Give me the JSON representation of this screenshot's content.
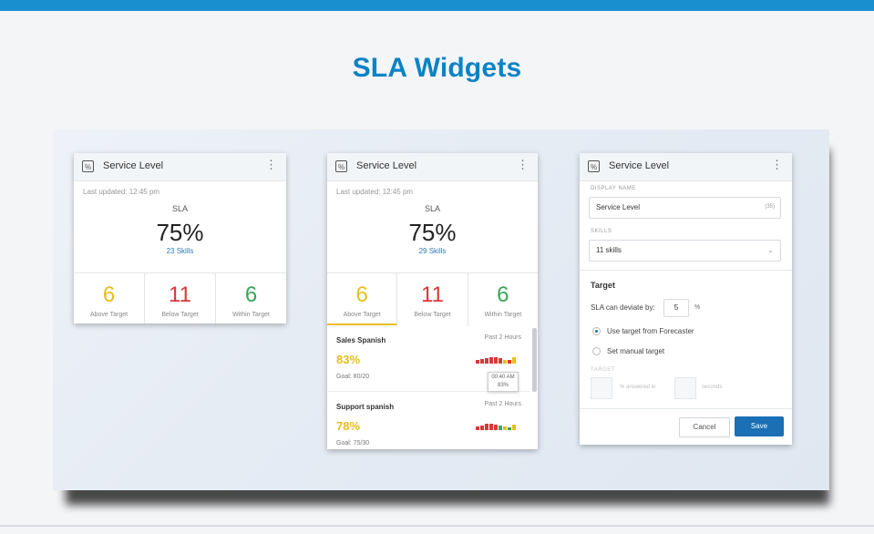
{
  "page": {
    "title": "SLA Widgets",
    "accent_color": "#1a8fd0"
  },
  "widget1": {
    "title": "Service Level",
    "icon": "percent-icon",
    "updated": "Last updated: 12:45 pm",
    "sla_label": "SLA",
    "sla_value": "75%",
    "skills_link": "23 Skills",
    "stats": [
      {
        "value": "6",
        "label": "Above Target"
      },
      {
        "value": "11",
        "label": "Below Target"
      },
      {
        "value": "6",
        "label": "Within Target"
      }
    ]
  },
  "widget2": {
    "title": "Service Level",
    "icon": "percent-icon",
    "updated": "Last updated: 12:45 pm",
    "sla_label": "SLA",
    "sla_value": "75%",
    "skills_link": "29 Skills",
    "stats": [
      {
        "value": "6",
        "label": "Above Target"
      },
      {
        "value": "11",
        "label": "Below Target"
      },
      {
        "value": "6",
        "label": "Within Target"
      }
    ],
    "skills": [
      {
        "name": "Sales Spanish",
        "pct": "83%",
        "goal": "Goal: 80/20",
        "period": "Past 2 Hours"
      },
      {
        "name": "Support spanish",
        "pct": "78%",
        "goal": "Goal: 75/30",
        "period": "Past 2 Hours"
      }
    ],
    "tooltip": {
      "time": "00:40 AM",
      "value": "83%"
    }
  },
  "widget3": {
    "title": "Service Level",
    "icon": "percent-icon",
    "display_name_label": "DISPLAY NAME",
    "display_name_value": "Service Level",
    "display_name_count": "(35)",
    "skills_label": "SKILLS",
    "skills_value": "11 skills",
    "target_title": "Target",
    "deviate_label": "SLA can deviate by:",
    "deviate_value": "5",
    "deviate_unit": "%",
    "radio_forecaster": "Use target from Forecaster",
    "radio_manual": "Set manual target",
    "target_label": "TARGET",
    "answered_in": "% answered in",
    "seconds": "seconds",
    "cancel": "Cancel",
    "save": "Save"
  }
}
